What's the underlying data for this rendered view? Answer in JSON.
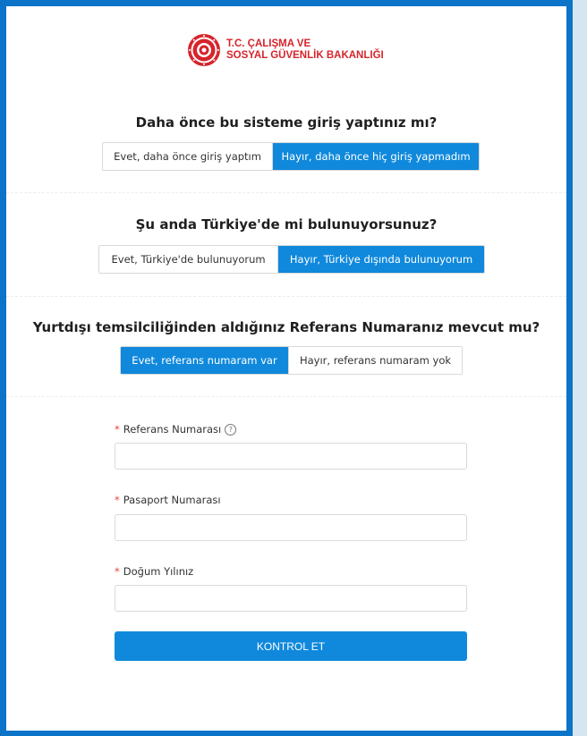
{
  "logo": {
    "icon": "ministry-emblem-icon",
    "line1": "T.C. ÇALIŞMA VE",
    "line2": "SOSYAL GÜVENLİK BAKANLIĞI"
  },
  "questions": [
    {
      "title": "Daha önce bu sisteme giriş yaptınız mı?",
      "options": [
        "Evet, daha önce giriş yaptım",
        "Hayır, daha önce hiç giriş yapmadım"
      ],
      "selected": 1
    },
    {
      "title": "Şu anda Türkiye'de mi bulunuyorsunuz?",
      "options": [
        "Evet, Türkiye'de bulunuyorum",
        "Hayır, Türkiye dışında bulunuyorum"
      ],
      "selected": 1
    },
    {
      "title": "Yurtdışı temsilciliğinden aldığınız Referans Numaranız mevcut mu?",
      "options": [
        "Evet, referans numaram var",
        "Hayır, referans numaram yok"
      ],
      "selected": 0
    }
  ],
  "form": {
    "required_mark": "*",
    "fields": [
      {
        "label": "Referans Numarası",
        "value": "",
        "help_icon": "question-circle-icon"
      },
      {
        "label": "Pasaport Numarası",
        "value": ""
      },
      {
        "label": "Doğum Yılınız",
        "value": ""
      }
    ],
    "help_glyph": "?",
    "submit_label": "KONTROL ET"
  },
  "colors": {
    "frame": "#0b73c8",
    "primary": "#1089dc",
    "logo_red": "#d6242b",
    "required": "#e0443a"
  }
}
